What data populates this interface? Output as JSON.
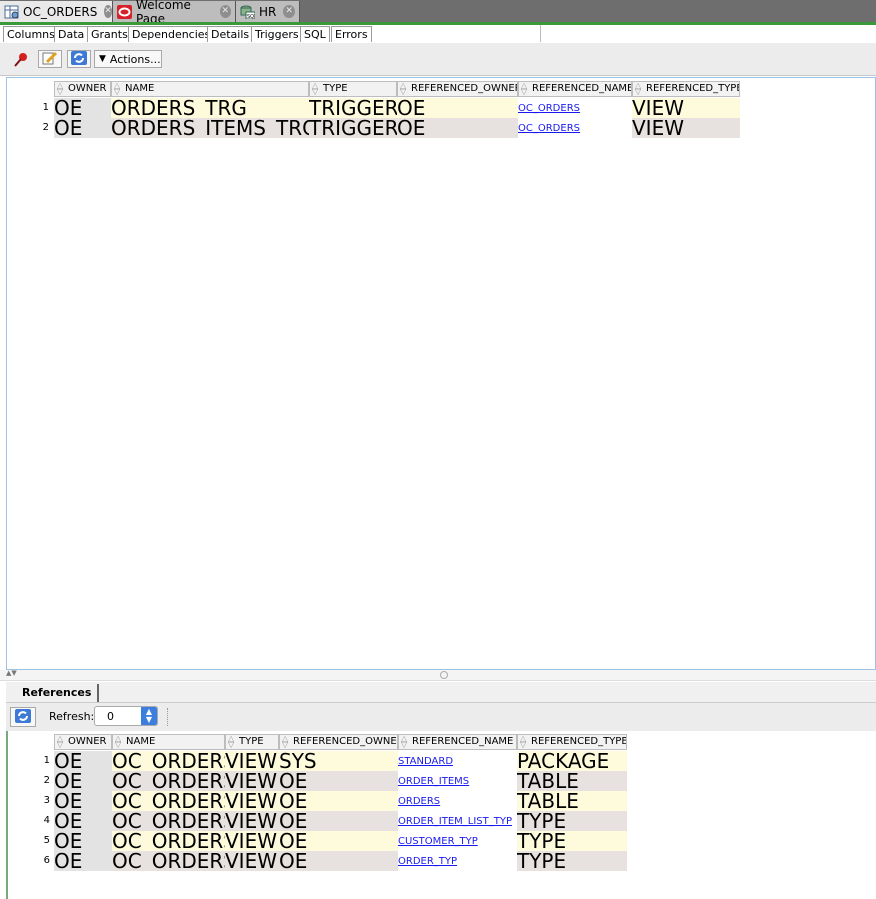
{
  "doc_tabs": [
    {
      "label": "OC_ORDERS",
      "icon": "table-view-icon",
      "active": true
    },
    {
      "label": "Welcome Page",
      "icon": "oracle-icon",
      "active": false
    },
    {
      "label": "HR",
      "icon": "sql-connection-icon",
      "active": false
    }
  ],
  "object_tabs": [
    "Columns",
    "Data",
    "Grants",
    "Dependencies",
    "Details",
    "Triggers",
    "SQL",
    "Errors"
  ],
  "toolbar": {
    "actions_label": "Actions..."
  },
  "dependencies": {
    "columns": [
      "OWNER",
      "NAME",
      "TYPE",
      "REFERENCED_OWNER",
      "REFERENCED_NAME",
      "REFERENCED_TYPE"
    ],
    "rows": [
      {
        "num": "1",
        "owner": "OE",
        "name": "ORDERS_TRG",
        "type": "TRIGGER",
        "referenced_owner": "OE",
        "referenced_name": "OC_ORDERS",
        "referenced_type": "VIEW"
      },
      {
        "num": "2",
        "owner": "OE",
        "name": "ORDERS_ITEMS_TRG",
        "type": "TRIGGER",
        "referenced_owner": "OE",
        "referenced_name": "OC_ORDERS",
        "referenced_type": "VIEW"
      }
    ]
  },
  "references": {
    "tab_label": "References",
    "refresh_label": "Refresh:",
    "refresh_value": "0",
    "columns": [
      "OWNER",
      "NAME",
      "TYPE",
      "REFERENCED_OWNER",
      "REFERENCED_NAME",
      "REFERENCED_TYPE"
    ],
    "rows": [
      {
        "num": "1",
        "owner": "OE",
        "name": "OC_ORDERS",
        "type": "VIEW",
        "referenced_owner": "SYS",
        "referenced_name": "STANDARD",
        "referenced_type": "PACKAGE"
      },
      {
        "num": "2",
        "owner": "OE",
        "name": "OC_ORDERS",
        "type": "VIEW",
        "referenced_owner": "OE",
        "referenced_name": "ORDER_ITEMS",
        "referenced_type": "TABLE"
      },
      {
        "num": "3",
        "owner": "OE",
        "name": "OC_ORDERS",
        "type": "VIEW",
        "referenced_owner": "OE",
        "referenced_name": "ORDERS",
        "referenced_type": "TABLE"
      },
      {
        "num": "4",
        "owner": "OE",
        "name": "OC_ORDERS",
        "type": "VIEW",
        "referenced_owner": "OE",
        "referenced_name": "ORDER_ITEM_LIST_TYP",
        "referenced_type": "TYPE"
      },
      {
        "num": "5",
        "owner": "OE",
        "name": "OC_ORDERS",
        "type": "VIEW",
        "referenced_owner": "OE",
        "referenced_name": "CUSTOMER_TYP",
        "referenced_type": "TYPE"
      },
      {
        "num": "6",
        "owner": "OE",
        "name": "OC_ORDERS",
        "type": "VIEW",
        "referenced_owner": "OE",
        "referenced_name": "ORDER_TYP",
        "referenced_type": "TYPE"
      }
    ]
  },
  "colors": {
    "green_accent": "#3a9a3a",
    "odd_row": "#fdfbdc",
    "even_row": "#e7e1df",
    "link": "#1a1aee"
  }
}
